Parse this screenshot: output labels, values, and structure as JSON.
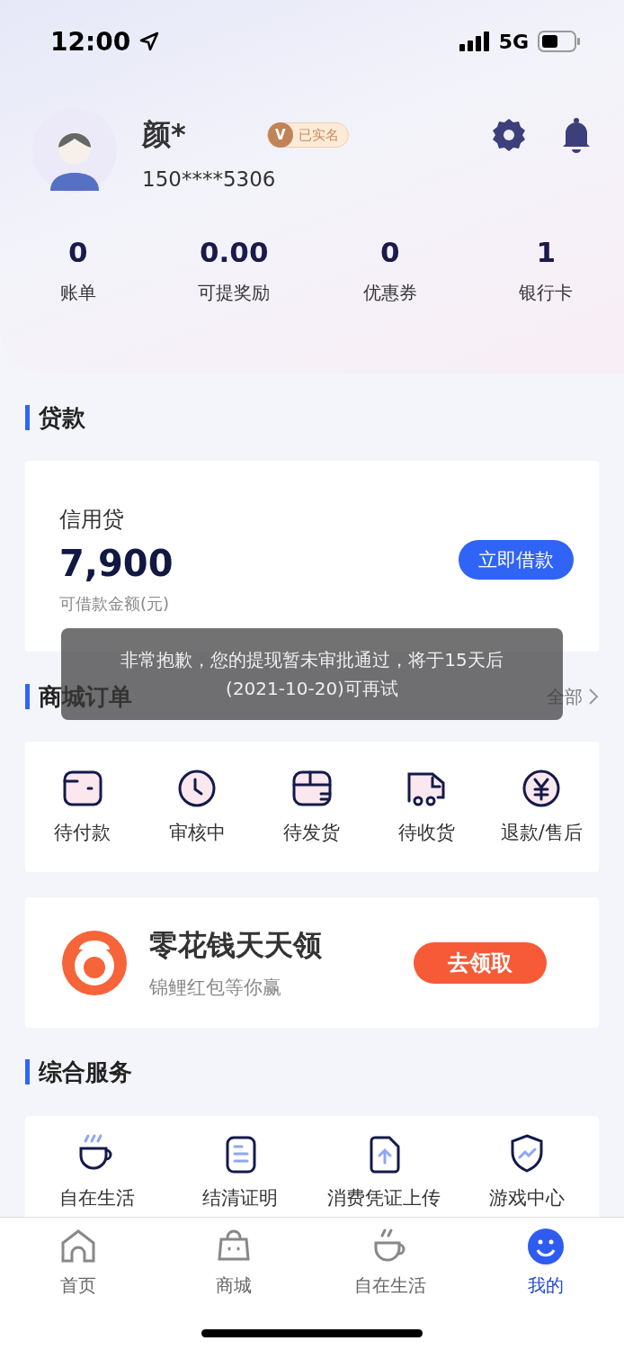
{
  "status_bar": {
    "time": "12:00",
    "network": "5G"
  },
  "profile": {
    "name": "颜*",
    "badge_mark": "V",
    "badge": "已实名",
    "phone": "150****5306"
  },
  "stats": [
    {
      "value": "0",
      "label": "账单"
    },
    {
      "value": "0.00",
      "label": "可提奖励"
    },
    {
      "value": "0",
      "label": "优惠券"
    },
    {
      "value": "1",
      "label": "银行卡"
    }
  ],
  "loan": {
    "title": "贷款",
    "product": "信用贷",
    "amount": "7,900",
    "amount_label": "可借款金额(元)",
    "button": "立即借款"
  },
  "orders": {
    "title": "商城订单",
    "more": "全部",
    "items": [
      {
        "label": "待付款",
        "kind": "wallet"
      },
      {
        "label": "审核中",
        "kind": "clock"
      },
      {
        "label": "待发货",
        "kind": "box"
      },
      {
        "label": "待收货",
        "kind": "truck"
      },
      {
        "label": "退款/售后",
        "kind": "refund"
      }
    ]
  },
  "promo": {
    "title": "零花钱天天领",
    "subtitle": "锦鲤红包等你赢",
    "button": "去领取"
  },
  "services": {
    "title": "综合服务",
    "items": [
      {
        "label": "自在生活",
        "kind": "cup"
      },
      {
        "label": "结清证明",
        "kind": "doc"
      },
      {
        "label": "消费凭证上传",
        "kind": "upload"
      },
      {
        "label": "游戏中心",
        "kind": "shield"
      }
    ]
  },
  "toast": {
    "lines": [
      "非常抱歉，您的提现暂未审批通过，将于15天后",
      "(2021-10-20)可再试"
    ]
  },
  "tabs": [
    {
      "label": "首页",
      "kind": "home",
      "selected": false
    },
    {
      "label": "商城",
      "kind": "bag",
      "selected": false
    },
    {
      "label": "自在生活",
      "kind": "cup",
      "selected": false
    },
    {
      "label": "我的",
      "kind": "smile",
      "selected": true
    }
  ]
}
